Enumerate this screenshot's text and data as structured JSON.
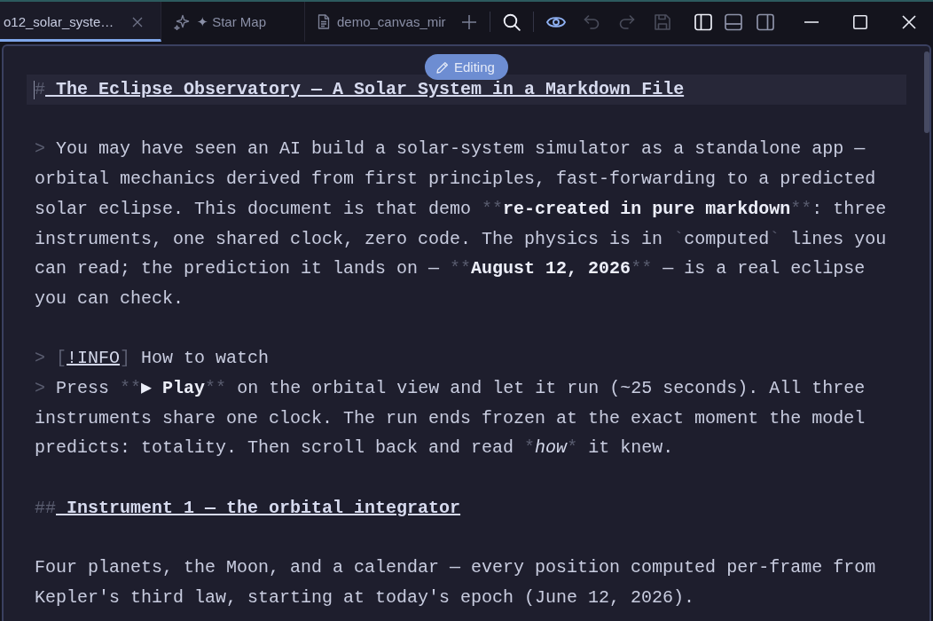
{
  "tabs": [
    {
      "kind": "clipped",
      "label": "o12_solar_syste…",
      "selected": true,
      "closable": true
    },
    {
      "kind": "view",
      "label": "✦ Star Map",
      "selected": false,
      "closable": false
    },
    {
      "kind": "file",
      "label": "demo_canvas_mir",
      "selected": false,
      "closable": false
    }
  ],
  "toolbar": [
    {
      "kind": "new-tab",
      "on": false,
      "disabled": false,
      "divider_after": true
    },
    {
      "kind": "search",
      "on": true,
      "disabled": false,
      "divider_after": true
    },
    {
      "kind": "preview",
      "on": true,
      "disabled": false,
      "divider_after": false
    },
    {
      "kind": "undo",
      "on": false,
      "disabled": true,
      "divider_after": false
    },
    {
      "kind": "redo",
      "on": false,
      "disabled": true,
      "divider_after": false
    },
    {
      "kind": "save",
      "on": false,
      "disabled": true,
      "divider_after": false
    },
    {
      "kind": "sidebar-left",
      "on": true,
      "disabled": false,
      "divider_after": false
    },
    {
      "kind": "panel-bottom",
      "on": false,
      "disabled": false,
      "divider_after": false
    },
    {
      "kind": "sidebar-right",
      "on": false,
      "disabled": false,
      "divider_after": false
    }
  ],
  "window_controls": [
    {
      "kind": "minimize"
    },
    {
      "kind": "maximize"
    },
    {
      "kind": "close"
    }
  ],
  "editor": {
    "mode_badge": {
      "label": "Editing"
    },
    "blocks": [
      {
        "kind": "heading",
        "active": true,
        "lines": [
          [
            {
              "kind": "syntax",
              "text": "#"
            },
            {
              "kind": "text",
              "text": " The Eclipse Observatory — A Solar System in a Markdown File"
            }
          ]
        ]
      },
      {
        "kind": "blockquote",
        "active": false,
        "lines": [
          [
            {
              "kind": "syntax",
              "text": "> "
            },
            {
              "kind": "text",
              "text": "You may have seen an AI build a solar-system simulator as a standalone app — orbital mechanics derived from first principles, fast-forwarding to a predicted solar eclipse. This document is that demo "
            },
            {
              "kind": "syntax",
              "text": "**"
            },
            {
              "kind": "bold",
              "text": "re-created in pure markdown"
            },
            {
              "kind": "syntax",
              "text": "**"
            },
            {
              "kind": "text",
              "text": ": three instruments, one shared clock, zero code. The physics is in "
            },
            {
              "kind": "syntax",
              "text": "`"
            },
            {
              "kind": "code",
              "text": "computed"
            },
            {
              "kind": "syntax",
              "text": "`"
            },
            {
              "kind": "text",
              "text": " lines you can read; the prediction it lands on — "
            },
            {
              "kind": "syntax",
              "text": "**"
            },
            {
              "kind": "bold",
              "text": "August 12, 2026"
            },
            {
              "kind": "syntax",
              "text": "**"
            },
            {
              "kind": "text",
              "text": " — is a real eclipse you can check."
            }
          ]
        ]
      },
      {
        "kind": "callout",
        "active": false,
        "lines": [
          [
            {
              "kind": "syntax",
              "text": "> "
            },
            {
              "kind": "syntax",
              "text": "["
            },
            {
              "kind": "tag",
              "text": "!INFO"
            },
            {
              "kind": "syntax",
              "text": "]"
            },
            {
              "kind": "text",
              "text": " How to watch"
            }
          ],
          [
            {
              "kind": "syntax",
              "text": "> "
            },
            {
              "kind": "text",
              "text": "Press "
            },
            {
              "kind": "syntax",
              "text": "**"
            },
            {
              "kind": "bold",
              "text": "▶ Play"
            },
            {
              "kind": "syntax",
              "text": "**"
            },
            {
              "kind": "text",
              "text": " on the orbital view and let it run (~25 seconds). All three instruments share one clock. The run ends frozen at the exact moment the model predicts: totality. Then scroll back and read "
            },
            {
              "kind": "syntax",
              "text": "*"
            },
            {
              "kind": "italic",
              "text": "how"
            },
            {
              "kind": "syntax",
              "text": "*"
            },
            {
              "kind": "text",
              "text": " it knew."
            }
          ]
        ]
      },
      {
        "kind": "heading",
        "active": false,
        "lines": [
          [
            {
              "kind": "syntax",
              "text": "##"
            },
            {
              "kind": "text",
              "text": " Instrument 1 — the orbital integrator"
            }
          ]
        ]
      },
      {
        "kind": "paragraph",
        "active": false,
        "lines": [
          [
            {
              "kind": "text",
              "text": "Four planets, the Moon, and a calendar — every position computed per-frame from Kepler's third law, starting at today's epoch (June 12, 2026)."
            }
          ]
        ]
      }
    ]
  }
}
